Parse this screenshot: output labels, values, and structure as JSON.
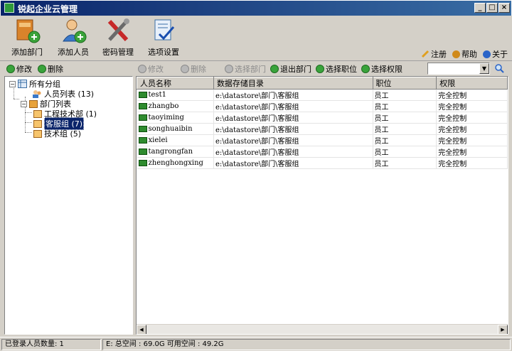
{
  "window": {
    "title": "锐起企业云管理",
    "minimize": "_",
    "maximize": "□",
    "close": "×"
  },
  "toolbar": {
    "items": [
      {
        "label": "添加部门",
        "icon": "add-department-icon"
      },
      {
        "label": "添加人员",
        "icon": "add-user-icon"
      },
      {
        "label": "密码管理",
        "icon": "tools-icon"
      },
      {
        "label": "选项设置",
        "icon": "settings-icon"
      }
    ],
    "help_links": [
      {
        "label": "注册",
        "icon": "pencil-icon"
      },
      {
        "label": "帮助",
        "icon": "help-icon"
      },
      {
        "label": "关于",
        "icon": "info-icon"
      }
    ]
  },
  "left_toolbar": {
    "edit": "修改",
    "delete": "删除"
  },
  "tree": {
    "root": "所有分组",
    "user_list": "人员列表 (13)",
    "dept_list": "部门列表",
    "departments": [
      "工程技术部 (1)",
      "客服组 (7)",
      "技术组 (5)"
    ],
    "selected": "客服组 (7)"
  },
  "right_toolbar": {
    "edit": "修改",
    "delete": "删除",
    "select_dept": "选择部门",
    "exit_dept": "退出部门",
    "select_position": "选择职位",
    "select_permission": "选择权限",
    "search_value": ""
  },
  "table": {
    "columns": [
      "人员名称",
      "数据存储目录",
      "职位",
      "权限"
    ],
    "rows": [
      [
        "test1",
        "e:\\datastore\\部门\\客服组",
        "员工",
        "完全控制"
      ],
      [
        "zhangbo",
        "e:\\datastore\\部门\\客服组",
        "员工",
        "完全控制"
      ],
      [
        "taoyiming",
        "e:\\datastore\\部门\\客服组",
        "员工",
        "完全控制"
      ],
      [
        "songhuaibin",
        "e:\\datastore\\部门\\客服组",
        "员工",
        "完全控制"
      ],
      [
        "xielei",
        "e:\\datastore\\部门\\客服组",
        "员工",
        "完全控制"
      ],
      [
        "tangrongfan",
        "e:\\datastore\\部门\\客服组",
        "员工",
        "完全控制"
      ],
      [
        "zhenghongxing",
        "e:\\datastore\\部门\\客服组",
        "员工",
        "完全控制"
      ]
    ]
  },
  "status": {
    "logged_in": "已登录人员数量: 1",
    "disk": "E: 总空间 : 69.0G 可用空间 : 49.2G"
  },
  "colors": {
    "titlebar": "#0a246a",
    "selection": "#0a246a",
    "accent_green": "#39a33b"
  }
}
